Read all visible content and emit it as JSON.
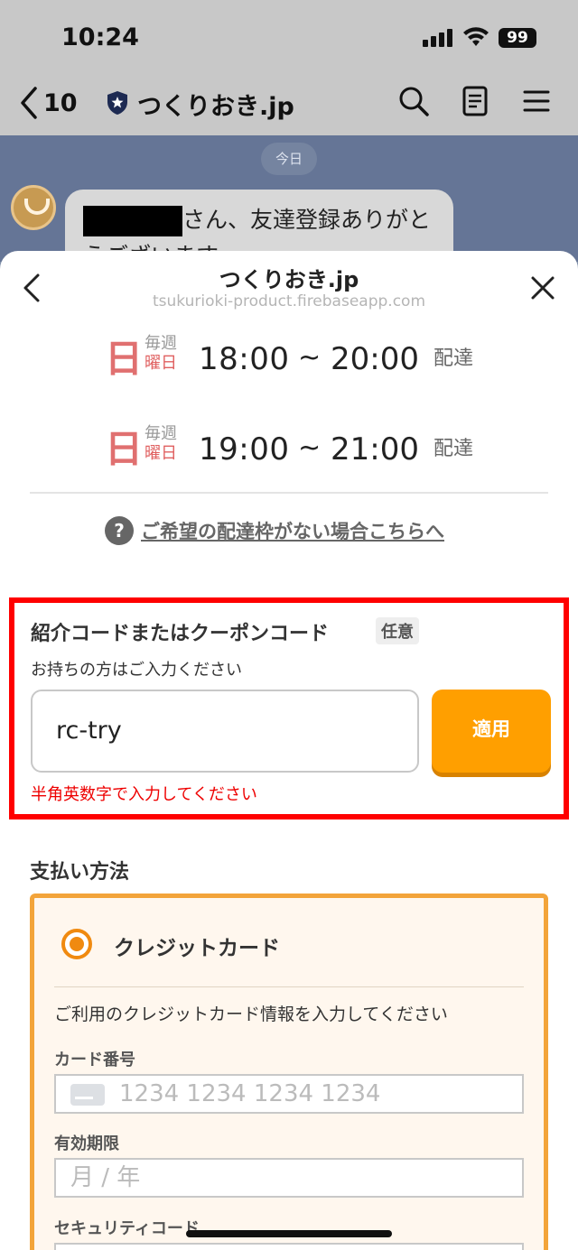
{
  "status_bar": {
    "time": "10:24",
    "battery": "99"
  },
  "line_header": {
    "back_count": "10",
    "title": "つくりおき.jp"
  },
  "chat": {
    "date_chip": "今日",
    "message_text": "さん、友達登録ありがとうございます"
  },
  "sheet": {
    "title": "つくりおき.jp",
    "url": "tsukurioki-product.firebaseapp.com"
  },
  "delivery_slots": [
    {
      "kanji": "日",
      "week": "毎週",
      "day": "曜日",
      "start": "18:00",
      "tilde": "~",
      "end": "20:00",
      "label": "配達"
    },
    {
      "kanji": "日",
      "week": "毎週",
      "day": "曜日",
      "start": "19:00",
      "tilde": "~",
      "end": "21:00",
      "label": "配達"
    }
  ],
  "help": {
    "icon": "?",
    "link": "ご希望の配達枠がない場合こちらへ"
  },
  "coupon": {
    "title": "紹介コードまたはクーポンコード",
    "badge": "任意",
    "subtitle": "お持ちの方はご入力ください",
    "value": "rc-try",
    "apply_label": "適用",
    "error": "半角英数字で入力してください"
  },
  "payment": {
    "title": "支払い方法",
    "method": "クレジットカード",
    "description": "ご利用のクレジットカード情報を入力してください",
    "card_number_label": "カード番号",
    "card_number_placeholder": "1234 1234 1234 1234",
    "expiry_label": "有効期限",
    "expiry_placeholder": "月 / 年",
    "cvc_label": "セキュリティコード"
  },
  "colors": {
    "accent": "#ff9f00",
    "error": "#ff0000",
    "radio": "#f08a10",
    "card_border": "#f3a43a"
  }
}
